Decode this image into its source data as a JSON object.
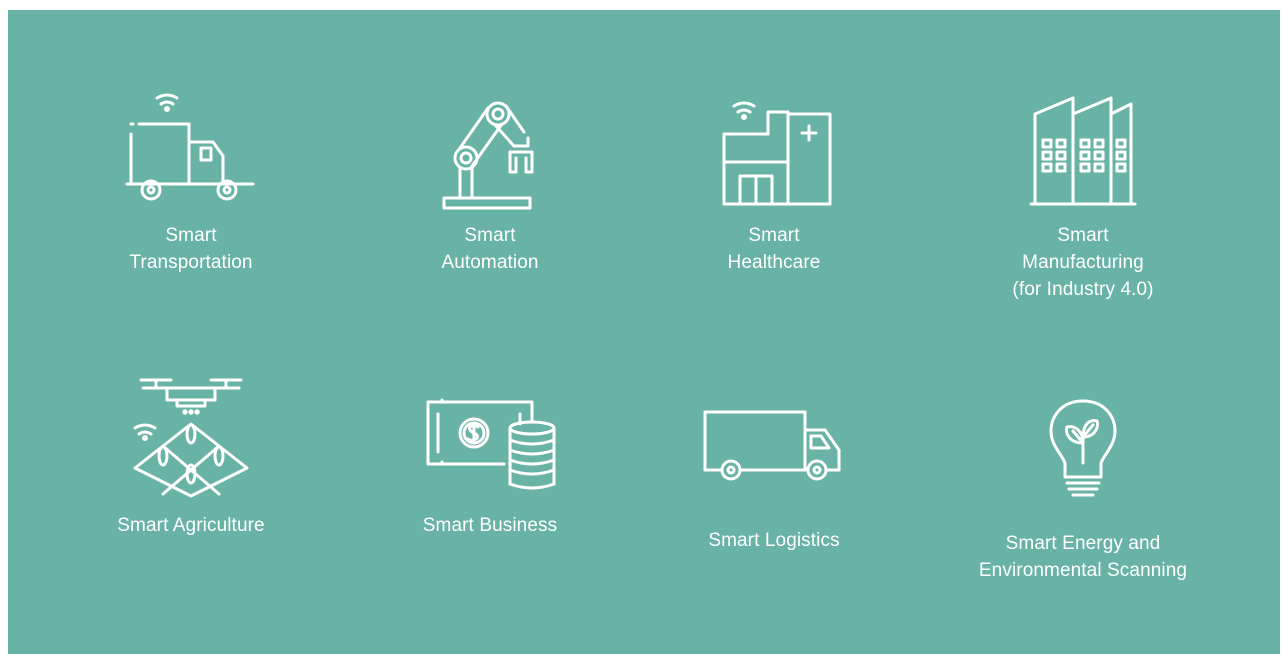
{
  "background_color": "#68b3a5",
  "icon_color": "#ffffff",
  "items": [
    {
      "icon": "connected-truck-icon",
      "lines": [
        "Smart",
        "Transportation"
      ]
    },
    {
      "icon": "robot-arm-icon",
      "lines": [
        "Smart",
        "Automation"
      ]
    },
    {
      "icon": "hospital-icon",
      "lines": [
        "Smart",
        "Healthcare"
      ]
    },
    {
      "icon": "factory-icon",
      "lines": [
        "Smart",
        "Manufacturing",
        "(for Industry 4.0)"
      ]
    },
    {
      "icon": "drone-field-icon",
      "lines": [
        "Smart Agriculture"
      ]
    },
    {
      "icon": "money-coins-icon",
      "lines": [
        "Smart Business"
      ]
    },
    {
      "icon": "delivery-truck-icon",
      "lines": [
        "Smart Logistics"
      ]
    },
    {
      "icon": "lightbulb-leaf-icon",
      "lines": [
        "Smart Energy and",
        "Environmental Scanning"
      ]
    }
  ]
}
